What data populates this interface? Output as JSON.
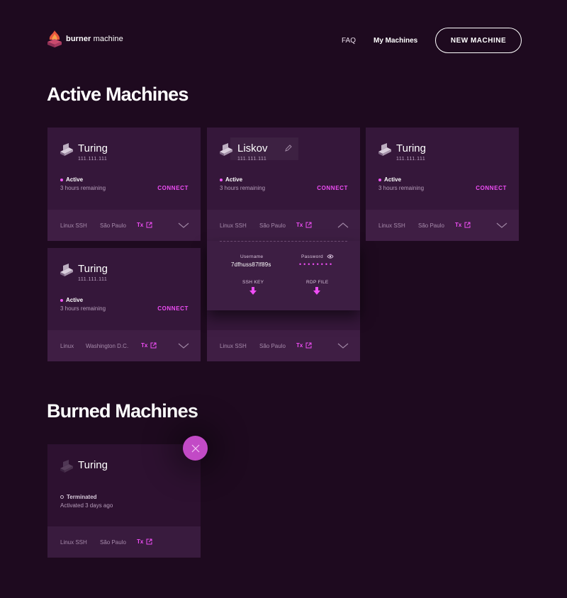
{
  "app": {
    "logo_bold": "burner",
    "logo_light": " machine"
  },
  "nav": {
    "faq": "FAQ",
    "my_machines": "My Machines",
    "new_machine": "NEW MACHINE"
  },
  "sections": {
    "active_title": "Active Machines",
    "burned_title": "Burned Machines"
  },
  "colors": {
    "background": "#1e0a1f",
    "accent": "#ef4df5",
    "card": "#35173a"
  },
  "active_machines": [
    {
      "name": "Turing",
      "ip": "111.111.111",
      "status": "Active",
      "remaining": "3 hours remaining",
      "connect": "CONNECT",
      "os": "Linux SSH",
      "location": "São Paulo",
      "tx": "Tx"
    },
    {
      "name": "Liskov",
      "ip": "111.111.111",
      "status": "Active",
      "remaining": "3 hours remaining",
      "connect": "CONNECT",
      "os": "Linux SSH",
      "location": "São Paulo",
      "tx": "Tx"
    },
    {
      "name": "Turing",
      "ip": "111.111.111",
      "status": "Active",
      "remaining": "3 hours remaining",
      "connect": "CONNECT",
      "os": "Linux SSH",
      "location": "São Paulo",
      "tx": "Tx"
    },
    {
      "name": "Turing",
      "ip": "111.111.111",
      "status": "Active",
      "remaining": "3 hours remaining",
      "connect": "CONNECT",
      "os": "Linux",
      "location": "Washington D.C.",
      "tx": "Tx"
    },
    {
      "os": "Linux SSH",
      "location": "São Paulo",
      "tx": "Tx"
    }
  ],
  "details": {
    "username_label": "Username",
    "username_value": "7dfhuss87lf89s",
    "password_label": "Password",
    "password_value": "••••••••",
    "ssh_key": "SSH KEY",
    "rdp_file": "RDP FILE"
  },
  "burned_machines": [
    {
      "name": "Turing",
      "status": "Terminated",
      "activated": "Activated 3 days ago",
      "os": "Linux SSH",
      "location": "São Paulo",
      "tx": "Tx"
    }
  ]
}
